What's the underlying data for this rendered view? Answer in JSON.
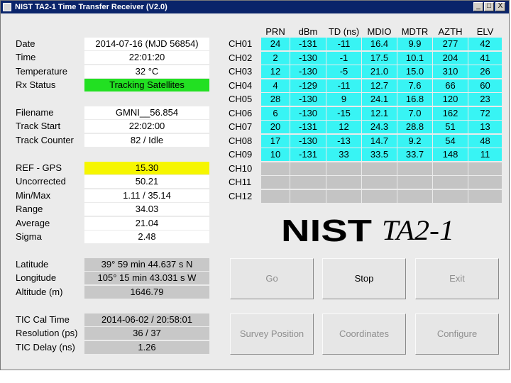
{
  "window": {
    "title": "NIST TA2-1 Time Transfer Receiver (V2.0)",
    "buttons": {
      "minimize": "_",
      "maximize": "□",
      "close": "X"
    }
  },
  "status": {
    "date_label": "Date",
    "date_value": "2014-07-16 (MJD 56854)",
    "time_label": "Time",
    "time_value": "22:01:20",
    "temp_label": "Temperature",
    "temp_value": "32 °C",
    "rx_label": "Rx Status",
    "rx_value": "Tracking Satellites"
  },
  "file": {
    "filename_label": "Filename",
    "filename_value": "GMNI__56.854",
    "start_label": "Track Start",
    "start_value": "22:02:00",
    "counter_label": "Track Counter",
    "counter_value": "82  / Idle"
  },
  "stats": {
    "ref_label": "REF - GPS",
    "ref_value": "15.30",
    "uncorr_label": "Uncorrected",
    "uncorr_value": "50.21",
    "minmax_label": "Min/Max",
    "minmax_value": "1.11  /  35.14",
    "range_label": "Range",
    "range_value": "34.03",
    "avg_label": "Average",
    "avg_value": "21.04",
    "sigma_label": "Sigma",
    "sigma_value": "2.48"
  },
  "position": {
    "lat_label": "Latitude",
    "lat_value": "39° 59 min 44.637 s N",
    "lon_label": "Longitude",
    "lon_value": "105° 15 min 43.031 s W",
    "alt_label": "Altitude (m)",
    "alt_value": "1646.79"
  },
  "tic": {
    "cal_label": "TIC Cal Time",
    "cal_value": "2014-06-02 / 20:58:01",
    "res_label": "Resolution (ps)",
    "res_value": "36 / 37",
    "delay_label": "TIC Delay (ns)",
    "delay_value": "1.26"
  },
  "channels": {
    "headers": [
      "PRN",
      "dBm",
      "TD (ns)",
      "MDIO",
      "MDTR",
      "AZTH",
      "ELV"
    ],
    "rows": [
      {
        "name": "CH01",
        "active": true,
        "values": [
          "24",
          "-131",
          "-11",
          "16.4",
          "9.9",
          "277",
          "42"
        ]
      },
      {
        "name": "CH02",
        "active": true,
        "values": [
          "2",
          "-130",
          "-1",
          "17.5",
          "10.1",
          "204",
          "41"
        ]
      },
      {
        "name": "CH03",
        "active": true,
        "values": [
          "12",
          "-130",
          "-5",
          "21.0",
          "15.0",
          "310",
          "26"
        ]
      },
      {
        "name": "CH04",
        "active": true,
        "values": [
          "4",
          "-129",
          "-11",
          "12.7",
          "7.6",
          "66",
          "60"
        ]
      },
      {
        "name": "CH05",
        "active": true,
        "values": [
          "28",
          "-130",
          "9",
          "24.1",
          "16.8",
          "120",
          "23"
        ]
      },
      {
        "name": "CH06",
        "active": true,
        "values": [
          "6",
          "-130",
          "-15",
          "12.1",
          "7.0",
          "162",
          "72"
        ]
      },
      {
        "name": "CH07",
        "active": true,
        "values": [
          "20",
          "-131",
          "12",
          "24.3",
          "28.8",
          "51",
          "13"
        ]
      },
      {
        "name": "CH08",
        "active": true,
        "values": [
          "17",
          "-130",
          "-13",
          "14.7",
          "9.2",
          "54",
          "48"
        ]
      },
      {
        "name": "CH09",
        "active": true,
        "values": [
          "10",
          "-131",
          "33",
          "33.5",
          "33.7",
          "148",
          "11"
        ]
      },
      {
        "name": "CH10",
        "active": false,
        "values": [
          "",
          "",
          "",
          "",
          "",
          "",
          ""
        ]
      },
      {
        "name": "CH11",
        "active": false,
        "values": [
          "",
          "",
          "",
          "",
          "",
          "",
          ""
        ]
      },
      {
        "name": "CH12",
        "active": false,
        "values": [
          "",
          "",
          "",
          "",
          "",
          "",
          ""
        ]
      }
    ]
  },
  "logo": {
    "nist": "NIST",
    "model": "TA2-1"
  },
  "buttons": {
    "go": "Go",
    "stop": "Stop",
    "exit": "Exit",
    "survey": "Survey Position",
    "coordinates": "Coordinates",
    "configure": "Configure"
  },
  "colors": {
    "active_cell": "#38f4f4",
    "inactive_cell": "#c4c4c4",
    "rx_ok": "#22e022",
    "ref_highlight": "#f6f600",
    "titlebar": "#0a246a"
  }
}
